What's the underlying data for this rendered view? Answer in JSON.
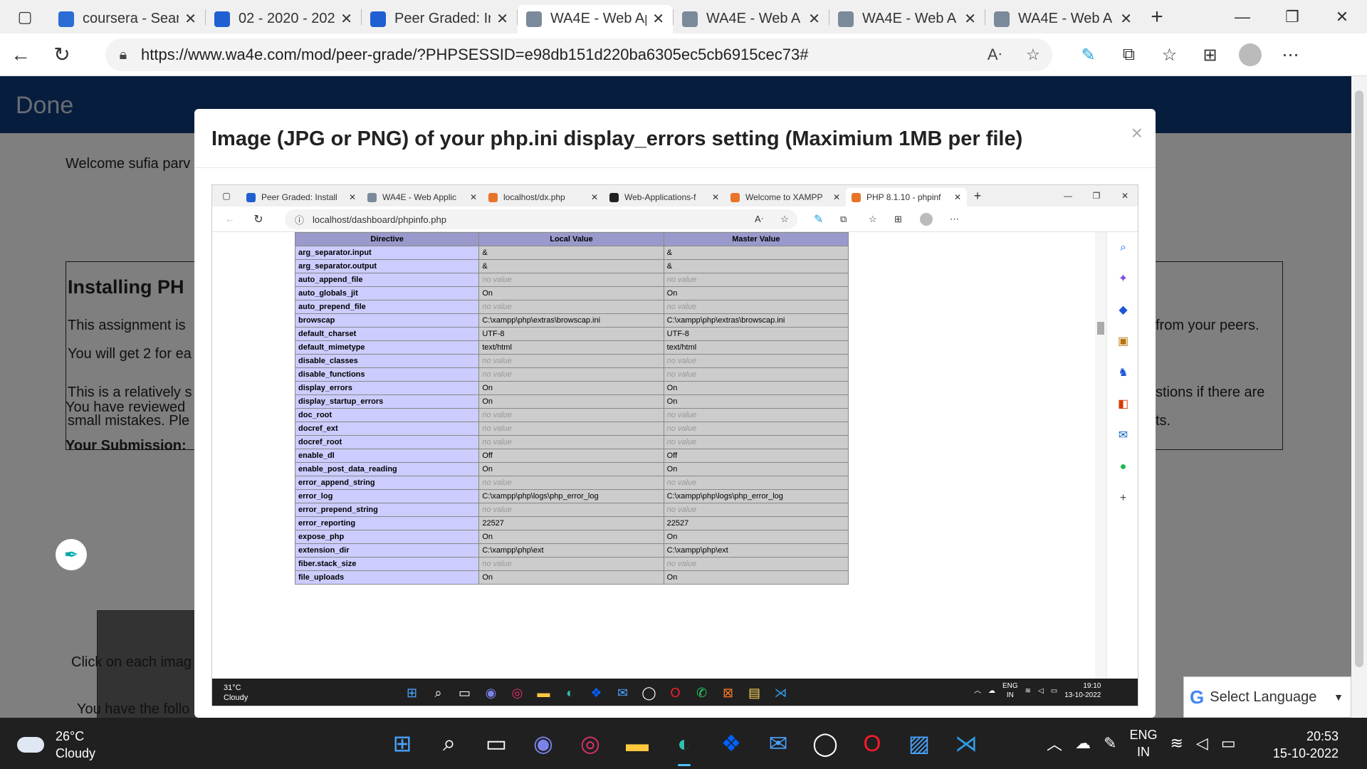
{
  "browser": {
    "tabs": [
      {
        "title": "coursera - Sear",
        "favicon": "search-icon",
        "color": "#2b6cd4",
        "active": false
      },
      {
        "title": "02 - 2020 - 202",
        "favicon": "coursera-icon",
        "color": "#1f5fd1",
        "active": false
      },
      {
        "title": "Peer Graded: In",
        "favicon": "coursera-icon",
        "color": "#1f5fd1",
        "active": false
      },
      {
        "title": "WA4E - Web Ap",
        "favicon": "wa4e-icon",
        "color": "#7a8a9a",
        "active": true
      },
      {
        "title": "WA4E - Web A",
        "favicon": "wa4e-icon",
        "color": "#7a8a9a",
        "active": false
      },
      {
        "title": "WA4E - Web A",
        "favicon": "wa4e-icon",
        "color": "#7a8a9a",
        "active": false
      },
      {
        "title": "WA4E - Web A",
        "favicon": "wa4e-icon",
        "color": "#7a8a9a",
        "active": false
      }
    ],
    "url": "https://www.wa4e.com/mod/peer-grade/?PHPSESSID=e98db151d220ba6305ec5cb6915cec73#"
  },
  "page": {
    "header": "Done",
    "welcome": "Welcome sufia parv",
    "section_title": "Installing PH",
    "p1": "This assignment is",
    "p2": "You will get 2 for ea",
    "p3": "This is a relatively s",
    "p4": "small mistakes. Ple",
    "p1_right": "from your peers.",
    "p3_right": "stions if there are",
    "p4_right": "ts.",
    "reviewed": "You have reviewed",
    "your_submission": "Your Submission:",
    "click_each": "Click on each imag",
    "following": "You have the follo",
    "select_language": "Select Language"
  },
  "modal": {
    "title": "Image (JPG or PNG) of your php.ini display_errors setting (Maximium 1MB per file)",
    "close": "×"
  },
  "inner": {
    "tabs": [
      {
        "title": "Peer Graded: Install",
        "color": "#1f5fd1",
        "active": false
      },
      {
        "title": "WA4E - Web Applic",
        "color": "#7a8a9a",
        "active": false
      },
      {
        "title": "localhost/dx.php",
        "color": "#e8742a",
        "active": false
      },
      {
        "title": "Web-Applications-f",
        "color": "#222222",
        "active": false
      },
      {
        "title": "Welcome to XAMPP",
        "color": "#e8742a",
        "active": false
      },
      {
        "title": "PHP 8.1.10 - phpinf",
        "color": "#e8742a",
        "active": true
      }
    ],
    "url": "localhost/dashboard/phpinfo.php",
    "table_headers": [
      "Directive",
      "Local Value",
      "Master Value"
    ],
    "rows": [
      [
        "arg_separator.input",
        "&",
        "&"
      ],
      [
        "arg_separator.output",
        "&",
        "&"
      ],
      [
        "auto_append_file",
        "no value",
        "no value"
      ],
      [
        "auto_globals_jit",
        "On",
        "On"
      ],
      [
        "auto_prepend_file",
        "no value",
        "no value"
      ],
      [
        "browscap",
        "C:\\xampp\\php\\extras\\browscap.ini",
        "C:\\xampp\\php\\extras\\browscap.ini"
      ],
      [
        "default_charset",
        "UTF-8",
        "UTF-8"
      ],
      [
        "default_mimetype",
        "text/html",
        "text/html"
      ],
      [
        "disable_classes",
        "no value",
        "no value"
      ],
      [
        "disable_functions",
        "no value",
        "no value"
      ],
      [
        "display_errors",
        "On",
        "On"
      ],
      [
        "display_startup_errors",
        "On",
        "On"
      ],
      [
        "doc_root",
        "no value",
        "no value"
      ],
      [
        "docref_ext",
        "no value",
        "no value"
      ],
      [
        "docref_root",
        "no value",
        "no value"
      ],
      [
        "enable_dl",
        "Off",
        "Off"
      ],
      [
        "enable_post_data_reading",
        "On",
        "On"
      ],
      [
        "error_append_string",
        "no value",
        "no value"
      ],
      [
        "error_log",
        "C:\\xampp\\php\\logs\\php_error_log",
        "C:\\xampp\\php\\logs\\php_error_log"
      ],
      [
        "error_prepend_string",
        "no value",
        "no value"
      ],
      [
        "error_reporting",
        "22527",
        "22527"
      ],
      [
        "expose_php",
        "On",
        "On"
      ],
      [
        "extension_dir",
        "C:\\xampp\\php\\ext",
        "C:\\xampp\\php\\ext"
      ],
      [
        "fiber.stack_size",
        "no value",
        "no value"
      ],
      [
        "file_uploads",
        "On",
        "On"
      ]
    ],
    "taskbar": {
      "temp": "31°C",
      "weather": "Cloudy",
      "lang1": "ENG",
      "lang2": "IN",
      "time": "19:10",
      "date": "13-10-2022"
    }
  },
  "taskbar": {
    "temp": "26°C",
    "weather": "Cloudy",
    "lang1": "ENG",
    "lang2": "IN",
    "time": "20:53",
    "date": "15-10-2022"
  }
}
